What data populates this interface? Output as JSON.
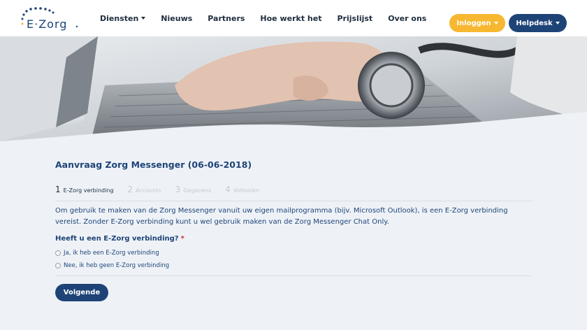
{
  "header": {
    "logo_text": "E·Zorg",
    "nav": [
      {
        "label": "Diensten",
        "dropdown": true
      },
      {
        "label": "Nieuws",
        "dropdown": false
      },
      {
        "label": "Partners",
        "dropdown": false
      },
      {
        "label": "Hoe werkt het",
        "dropdown": false
      },
      {
        "label": "Prijslijst",
        "dropdown": false
      },
      {
        "label": "Over ons",
        "dropdown": false
      }
    ],
    "login_label": "Inloggen",
    "help_label": "Helpdesk"
  },
  "page": {
    "title": "Aanvraag Zorg Messenger (06-06-2018)",
    "steps": [
      {
        "num": "1",
        "label": "E-Zorg verbinding",
        "active": true
      },
      {
        "num": "2",
        "label": "Accounts",
        "active": false
      },
      {
        "num": "3",
        "label": "Gegevens",
        "active": false
      },
      {
        "num": "4",
        "label": "Voltooien",
        "active": false
      }
    ],
    "intro": "Om gebruik te maken van de Zorg Messenger vanuit uw eigen mailprogramma (bijv. Microsoft Outlook), is een E-Zorg verbinding vereist. Zonder E-Zorg verbinding kunt u wel gebruik maken van de Zorg Messenger Chat Only.",
    "question": "Heeft u een E-Zorg verbinding?",
    "required_mark": "*",
    "options": [
      "Ja, ik heb een E-Zorg verbinding",
      "Nee, ik heb geen E-Zorg verbinding"
    ],
    "next_label": "Volgende"
  },
  "colors": {
    "brand_blue": "#1e4477",
    "brand_yellow": "#f7b731",
    "background": "#eef2f7"
  }
}
